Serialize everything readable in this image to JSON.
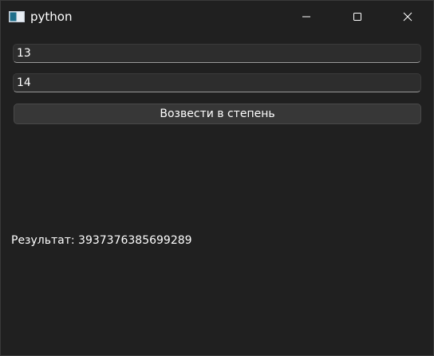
{
  "window": {
    "title": "python",
    "icon": "app-window-icon",
    "controls": [
      "minimize-icon",
      "maximize-icon",
      "close-icon"
    ]
  },
  "inputs": {
    "first_value": "13",
    "second_value": "14"
  },
  "action": {
    "label": "Возвести в степень"
  },
  "result": {
    "text": "Результат: 3937376385699289"
  },
  "colors": {
    "background": "#202020",
    "field": "#2d2d2d",
    "button": "#373737",
    "text": "#ffffff"
  }
}
